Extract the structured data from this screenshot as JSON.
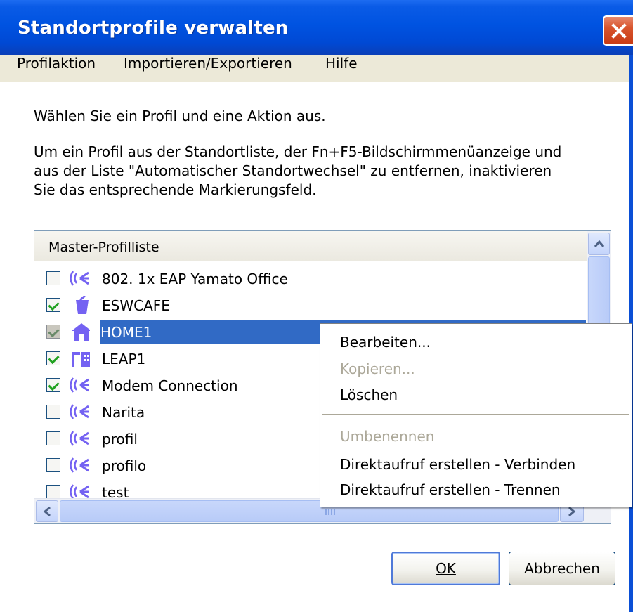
{
  "window": {
    "title": "Standortprofile verwalten"
  },
  "menubar": {
    "items": [
      "Profilaktion",
      "Importieren/Exportieren",
      "Hilfe"
    ]
  },
  "content": {
    "instruction1": "Wählen Sie ein Profil und eine Aktion aus.",
    "instruction2_lines": [
      "Um ein Profil aus der Standortliste, der Fn+F5-Bildschirmmenüanzeige und",
      "aus der Liste \"Automatischer Standortwechsel\" zu entfernen, inaktivieren",
      "Sie das entsprechende Markierungsfeld."
    ]
  },
  "profile_list": {
    "header": "Master-Profilliste",
    "items": [
      {
        "label": "802. 1x EAP Yamato Office",
        "checked": false,
        "icon": "wireless-icon"
      },
      {
        "label": "ESWCAFE",
        "checked": true,
        "icon": "coffee-cup-icon"
      },
      {
        "label": "HOME1",
        "checked": true,
        "icon": "home-icon",
        "selected": true
      },
      {
        "label": "LEAP1",
        "checked": true,
        "icon": "office-building-icon"
      },
      {
        "label": "Modem Connection",
        "checked": true,
        "icon": "wireless-icon"
      },
      {
        "label": "Narita",
        "checked": false,
        "icon": "wireless-icon"
      },
      {
        "label": "profil",
        "checked": false,
        "icon": "wireless-icon"
      },
      {
        "label": "profilo",
        "checked": false,
        "icon": "wireless-icon"
      },
      {
        "label": "test",
        "checked": false,
        "icon": "wireless-icon"
      }
    ]
  },
  "context_menu": {
    "items": [
      {
        "label": "Bearbeiten...",
        "enabled": true
      },
      {
        "label": "Kopieren...",
        "enabled": false
      },
      {
        "label": "Löschen",
        "enabled": true
      },
      {
        "label": "Umbenennen",
        "enabled": false
      },
      {
        "label": "Direktaufruf erstellen - Verbinden",
        "enabled": true
      },
      {
        "label": "Direktaufruf erstellen - Trennen",
        "enabled": true
      }
    ]
  },
  "buttons": {
    "ok_label": "OK",
    "cancel_label": "Abbrechen"
  },
  "colors": {
    "titlebar": "#0053e1",
    "selection": "#316ac5",
    "icon": "#6a5af5",
    "menubar": "#ece9d8"
  }
}
